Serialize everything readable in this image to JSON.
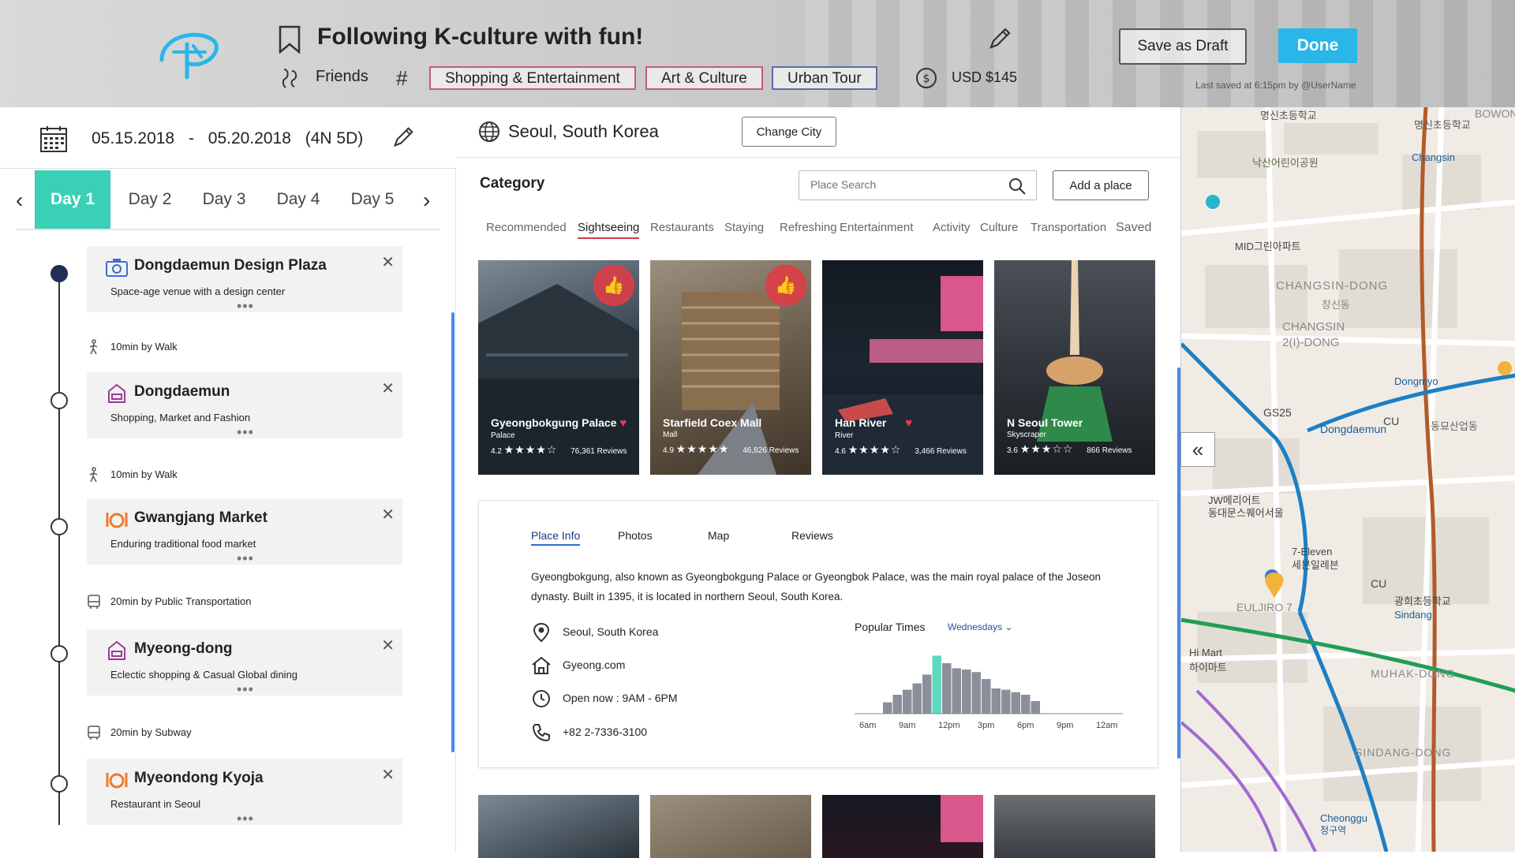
{
  "header": {
    "title": "Following K-culture with fun!",
    "companion": "Friends",
    "hash_symbol": "#",
    "tags": [
      "Shopping & Entertainment",
      "Art & Culture",
      "Urban Tour"
    ],
    "budget": "USD $145",
    "save_draft_label": "Save as Draft",
    "done_label": "Done",
    "last_saved": "Last saved at 6:15pm by @UserName"
  },
  "trip": {
    "start_date": "05.15.2018",
    "dash": "-",
    "end_date": "05.20.2018",
    "duration": "(4N 5D)",
    "days": [
      "Day 1",
      "Day 2",
      "Day 3",
      "Day 4",
      "Day 5"
    ],
    "active_day": 0
  },
  "itinerary": [
    {
      "title": "Dongdaemun Design Plaza",
      "subtitle": "Space-age venue with a design center",
      "icon": "camera-icon",
      "more": "•••"
    },
    {
      "title": "Dongdaemun",
      "subtitle": "Shopping, Market and Fashion",
      "icon": "shopping-icon",
      "more": "•••"
    },
    {
      "title": "Gwangjang Market",
      "subtitle": "Enduring traditional food market",
      "icon": "restaurant-icon",
      "more": "•••"
    },
    {
      "title": "Myeong-dong",
      "subtitle": "Eclectic shopping & Casual Global dining",
      "icon": "shopping-icon",
      "more": "•••"
    },
    {
      "title": "Myeondong Kyoja",
      "subtitle": "Restaurant in Seoul",
      "icon": "restaurant-icon",
      "more": "•••"
    }
  ],
  "transits": [
    {
      "text": "10min by Walk",
      "icon": "walk-icon"
    },
    {
      "text": "10min by Walk",
      "icon": "walk-icon"
    },
    {
      "text": "20min by Public Transportation",
      "icon": "bus-icon"
    },
    {
      "text": "20min by Subway",
      "icon": "subway-icon"
    }
  ],
  "city": {
    "name": "Seoul, South Korea",
    "change_label": "Change City"
  },
  "category": {
    "title": "Category",
    "search_placeholder": "Place Search",
    "add_label": "Add a place",
    "tabs": [
      "Recommended",
      "Sightseeing",
      "Restaurants",
      "Staying",
      "Refreshing",
      "Entertainment",
      "Activity",
      "Culture",
      "Transportation",
      "Saved"
    ],
    "active_tab": 1
  },
  "places": [
    {
      "name": "Gyeongbokgung Palace",
      "type": "Palace",
      "rating": "4.2",
      "stars": "★★★★☆",
      "reviews": "76,361 Reviews",
      "liked": true,
      "badge": true
    },
    {
      "name": "Starfield Coex Mall",
      "type": "Mall",
      "rating": "4.9",
      "stars": "★★★★★",
      "reviews": "46,826 Reviews",
      "liked": false,
      "badge": true
    },
    {
      "name": "Han River",
      "type": "River",
      "rating": "4.6",
      "stars": "★★★★☆",
      "reviews": "3,466 Reviews",
      "liked": true,
      "badge": false
    },
    {
      "name": "N Seoul Tower",
      "type": "Skyscraper",
      "rating": "3.6",
      "stars": "★★★☆☆",
      "reviews": "866 Reviews",
      "liked": false,
      "badge": false
    }
  ],
  "detail": {
    "tabs": [
      "Place Info",
      "Photos",
      "Map",
      "Reviews"
    ],
    "active_tab": 0,
    "description": "Gyeongbokgung, also known as Gyeongbokgung Palace or Gyeongbok Palace, was the main royal palace of the Joseon dynasty. Built in 1395, it is located in northern Seoul, South Korea.",
    "location": "Seoul, South Korea",
    "website": "Gyeong.com",
    "hours": "Open now : 9AM - 6PM",
    "phone": "+82 2-7336-3100",
    "popular_times_label": "Popular Times",
    "popular_day": "Wednesdays",
    "chart_labels": [
      "6am",
      "9am",
      "12pm",
      "3pm",
      "6pm",
      "9pm",
      "12am"
    ],
    "chart_values": [
      18,
      30,
      38,
      48,
      62,
      92,
      80,
      72,
      70,
      66,
      55,
      40,
      38,
      34,
      30,
      20
    ],
    "chart_highlight": 5,
    "chart_colors": {
      "bar": "#8a8f99",
      "highlight": "#5fd9bd"
    }
  },
  "map": {
    "labels": [
      "명신초등학교",
      "Changsin",
      "낙산어린이공원",
      "MID그린아파트",
      "CHANGSIN-DONG",
      "창신동",
      "CHANGSIN",
      "2(I)-DONG",
      "Dongmyo",
      "GS25",
      "Dongdaemun",
      "CU",
      "동묘산업동",
      "JW메리어트",
      "동대문스퀘어서울",
      "7-Eleven",
      "세븐일레븐",
      "CU",
      "광희초등학교",
      "Sindang",
      "Hi Mart",
      "하이마트",
      "EULJIRO 7",
      "MUHAK-DONG",
      "SINDANG-DONG",
      "Cheonggu",
      "청구역",
      "BOWON"
    ]
  },
  "colors": {
    "accent_teal": "#3ad0b5",
    "done_blue": "#29b6e8",
    "tag_pink": "#c75c72",
    "tag_blue": "#5a6ea8",
    "active_underline": "#d4374f"
  }
}
